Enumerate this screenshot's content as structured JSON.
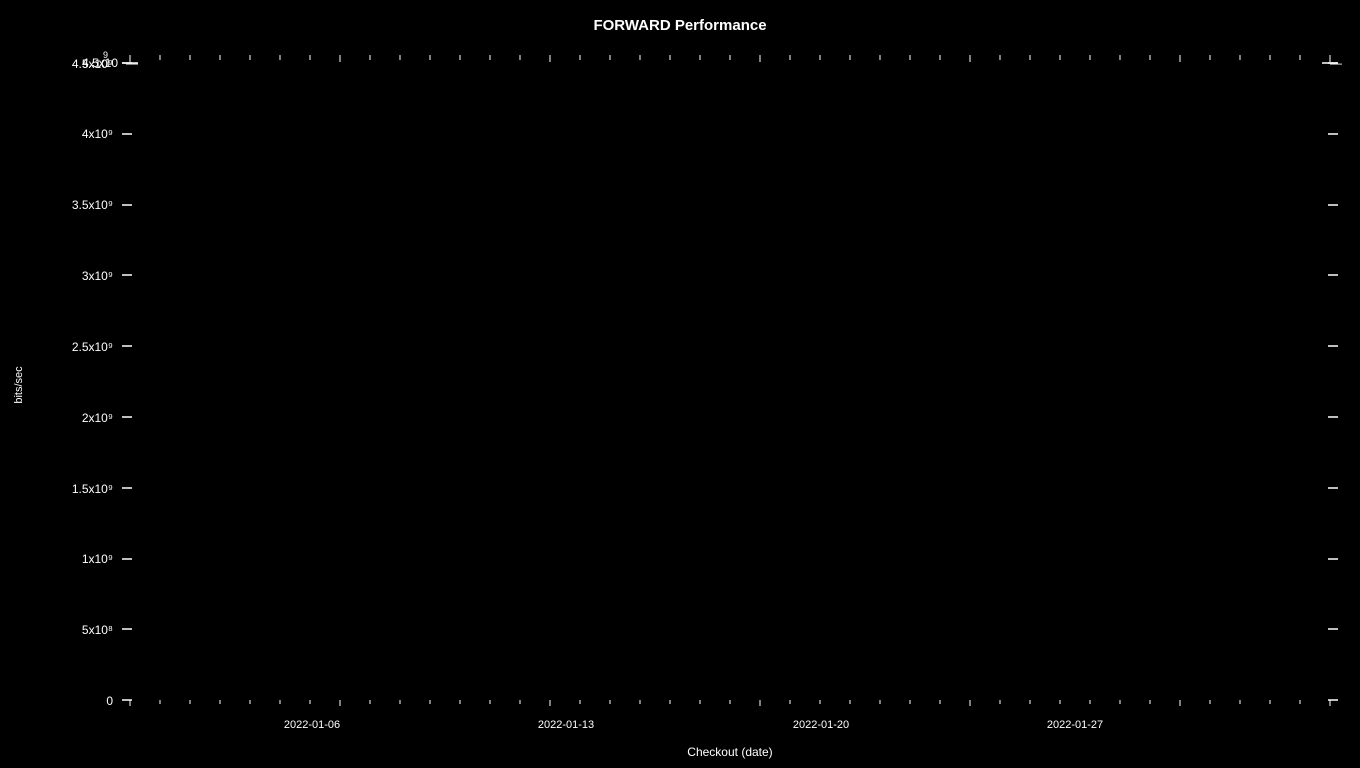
{
  "chart": {
    "title": "FORWARD Performance",
    "x_axis_label": "Checkout (date)",
    "y_axis_label": "bits/sec",
    "y_ticks": [
      {
        "value": "4.5x10⁹",
        "percent": 100
      },
      {
        "value": "4x10⁹",
        "percent": 88.89
      },
      {
        "value": "3.5x10⁹",
        "percent": 77.78
      },
      {
        "value": "3x10⁹",
        "percent": 66.67
      },
      {
        "value": "2.5x10⁹",
        "percent": 55.56
      },
      {
        "value": "2x10⁹",
        "percent": 44.44
      },
      {
        "value": "1.5x10⁹",
        "percent": 33.33
      },
      {
        "value": "1x10⁹",
        "percent": 22.22
      },
      {
        "value": "5x10⁸",
        "percent": 11.11
      },
      {
        "value": "0",
        "percent": 0
      }
    ],
    "x_ticks": [
      {
        "label": "2022-01-06",
        "percent": 16.67
      },
      {
        "label": "2022-01-13",
        "percent": 38.89
      },
      {
        "label": "2022-01-20",
        "percent": 61.11
      },
      {
        "label": "2022-01-27",
        "percent": 83.33
      }
    ],
    "colors": {
      "background": "#000000",
      "text": "#ffffff",
      "grid": "#333333",
      "tick": "#555555"
    }
  }
}
